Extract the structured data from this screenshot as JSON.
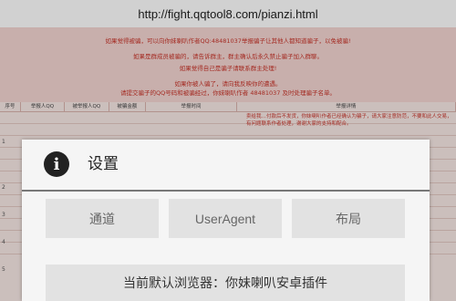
{
  "browser": {
    "url": "http://fight.qqtool8.com/pianzi.html"
  },
  "page": {
    "notices": [
      "如果觉得被骗，可以向你妹喇叭作者QQ:48481037举报骗子让其他人都知道骗子，以免被骗!",
      "如果是群成员被骗的，请告诉群主，群主确认后永久禁止骗子加入群聊。",
      "如果觉得自己是骗子请联系群主处理!",
      "如果你被人骗了，请向我反映你的遭遇。",
      "请提交骗子的QQ号码和被骗经过，你妹喇叭作者 48481037 及时处理骗子名单。"
    ],
    "table_headers": [
      "序号",
      "举报人QQ",
      "被举报人QQ",
      "被骗金额",
      "举报时间",
      "举报详情"
    ],
    "row_numbers": [
      "1",
      "2",
      "3",
      "4",
      "5"
    ],
    "side_text": "卖给我…付款后不发货，你妹喇叭作者已经确认为骗子，请大家注意防范，不要和此人交易，有问题联系作者处理，谢谢大家的支持和配合。"
  },
  "dialog": {
    "title": "设置",
    "icon": "info-icon",
    "buttons": {
      "channel": "通道",
      "useragent": "UserAgent",
      "layout": "布局"
    },
    "default_browser": "当前默认浏览器：你妹喇叭安卓插件"
  }
}
